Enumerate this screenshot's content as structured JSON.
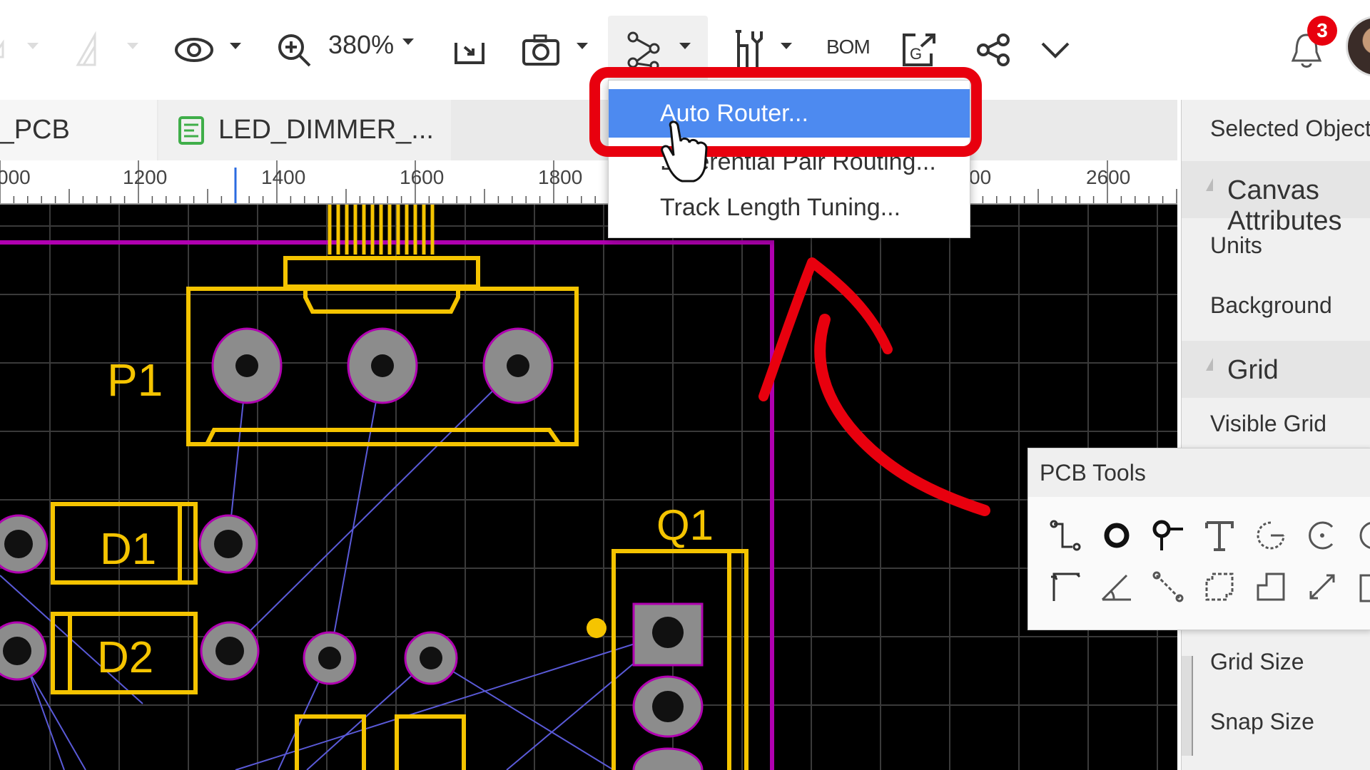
{
  "toolbar": {
    "zoom": "380%",
    "bom_label": "BOM"
  },
  "tabs": [
    {
      "label": "/_PCB"
    },
    {
      "label": "LED_DIMMER_..."
    }
  ],
  "ruler": {
    "ticks": [
      "000",
      "1200",
      "1400",
      "1600",
      "1800",
      "00",
      "2600"
    ]
  },
  "route_menu": {
    "items": [
      "Auto Router...",
      "Differential Pair Routing...",
      "Track Length Tuning..."
    ]
  },
  "right_panel": {
    "title": "Selected Objects",
    "canvas_section": "Canvas Attributes",
    "units_label": "Units",
    "background_label": "Background",
    "grid_section": "Grid",
    "visible_grid_label": "Visible Grid",
    "grid_size_label": "Grid Size",
    "snap_size_label": "Snap Size"
  },
  "pcb_tools": {
    "title": "PCB Tools"
  },
  "pcb": {
    "labels": [
      "P1",
      "D1",
      "D2",
      "Q1"
    ]
  },
  "notifications": {
    "count": "3"
  },
  "colors": {
    "accent_red": "#e8000e",
    "menu_highlight": "#4d8af0",
    "silkscreen": "#f5c400",
    "board_outline": "#b000b0",
    "pad": "#8c8c8c"
  }
}
